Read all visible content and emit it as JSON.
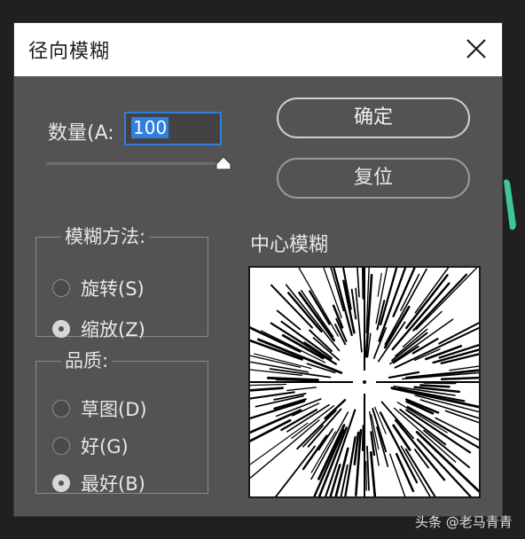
{
  "dialog": {
    "title": "径向模糊"
  },
  "amount": {
    "label": "数量(A:",
    "value": "100"
  },
  "buttons": {
    "ok_label": "确定",
    "reset_label": "复位"
  },
  "blur_method": {
    "legend": "模糊方法:",
    "options": [
      {
        "label": "旋转(S)",
        "checked": false
      },
      {
        "label": "缩放(Z)",
        "checked": true
      }
    ]
  },
  "quality": {
    "legend": "品质:",
    "options": [
      {
        "label": "草图(D)",
        "checked": false
      },
      {
        "label": "好(G)",
        "checked": false
      },
      {
        "label": "最好(B)",
        "checked": true
      }
    ]
  },
  "preview": {
    "label": "中心模糊"
  },
  "watermark": {
    "text": "头条 @老马青青"
  },
  "colors": {
    "dialog_bg": "#535353",
    "titlebar_bg": "#ffffff",
    "input_focus": "#2f7fe0",
    "decoration": "#3ec796"
  }
}
